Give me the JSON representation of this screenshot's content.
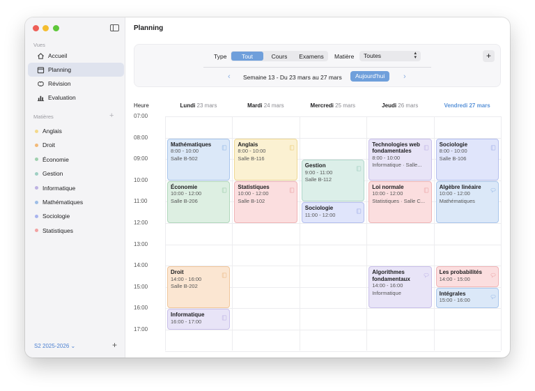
{
  "sidebar": {
    "section_vues": "Vues",
    "nav": [
      {
        "label": "Accueil",
        "icon": "house-icon"
      },
      {
        "label": "Planning",
        "icon": "calendar-icon",
        "active": true
      },
      {
        "label": "Révision",
        "icon": "brain-icon"
      },
      {
        "label": "Evaluation",
        "icon": "chart-bar-icon"
      }
    ],
    "section_matieres": "Matières",
    "subjects": [
      {
        "label": "Anglais",
        "color": "#f3d98b"
      },
      {
        "label": "Droit",
        "color": "#f2b978"
      },
      {
        "label": "Économie",
        "color": "#9fd0ae"
      },
      {
        "label": "Gestion",
        "color": "#9fcfc3"
      },
      {
        "label": "Informatique",
        "color": "#bdb2e2"
      },
      {
        "label": "Mathématiques",
        "color": "#9dbde6"
      },
      {
        "label": "Sociologie",
        "color": "#a8b3ee"
      },
      {
        "label": "Statistiques",
        "color": "#f2a2a2"
      }
    ],
    "semester": "S2 2025-2026"
  },
  "header": {
    "title": "Planning"
  },
  "toolbar": {
    "type_label": "Type",
    "type_options": [
      "Tout",
      "Cours",
      "Examens"
    ],
    "type_selected": "Tout",
    "matiere_label": "Matière",
    "matiere_value": "Toutes",
    "add_label": "+",
    "week_label": "Semaine 13 - Du 23 mars au 27 mars",
    "today_label": "Aujourd'hui"
  },
  "calendar": {
    "hour_header": "Heure",
    "days": [
      {
        "name": "Lundi",
        "date": "23 mars"
      },
      {
        "name": "Mardi",
        "date": "24 mars"
      },
      {
        "name": "Mercredi",
        "date": "25 mars"
      },
      {
        "name": "Jeudi",
        "date": "26 mars"
      },
      {
        "name": "Vendredi",
        "date": "27 mars",
        "today": true
      }
    ],
    "hours": [
      "07:00",
      "08:00",
      "09:00",
      "10:00",
      "11:00",
      "12:00",
      "13:00",
      "14:00",
      "15:00",
      "16:00",
      "17:00"
    ],
    "events": [
      {
        "day": 0,
        "start": 8,
        "end": 10,
        "title": "Mathématiques",
        "time": "8:00 - 10:00",
        "detail": "Salle B-502",
        "kind": "cours",
        "subject": "Mathématiques"
      },
      {
        "day": 0,
        "start": 10,
        "end": 12,
        "title": "Économie",
        "time": "10:00 - 12:00",
        "detail": "Salle B-206",
        "kind": "cours",
        "subject": "Économie"
      },
      {
        "day": 0,
        "start": 14,
        "end": 16,
        "title": "Droit",
        "time": "14:00 - 16:00",
        "detail": "Salle B-202",
        "kind": "cours",
        "subject": "Droit"
      },
      {
        "day": 0,
        "start": 16,
        "end": 17,
        "title": "Informatique",
        "time": "16:00 - 17:00",
        "detail": "",
        "kind": "cours",
        "subject": "Informatique"
      },
      {
        "day": 1,
        "start": 8,
        "end": 10,
        "title": "Anglais",
        "time": "8:00 - 10:00",
        "detail": "Salle B-116",
        "kind": "cours",
        "subject": "Anglais"
      },
      {
        "day": 1,
        "start": 10,
        "end": 12,
        "title": "Statistiques",
        "time": "10:00 - 12:00",
        "detail": "Salle B-102",
        "kind": "cours",
        "subject": "Statistiques"
      },
      {
        "day": 2,
        "start": 9,
        "end": 11,
        "title": "Gestion",
        "time": "9:00 - 11:00",
        "detail": "Salle B-112",
        "kind": "cours",
        "subject": "Gestion"
      },
      {
        "day": 2,
        "start": 11,
        "end": 12,
        "title": "Sociologie",
        "time": "11:00 - 12:00",
        "detail": "",
        "kind": "cours",
        "subject": "Sociologie"
      },
      {
        "day": 3,
        "start": 8,
        "end": 10,
        "title": "Technologies web fondamentales",
        "time": "8:00 - 10:00",
        "detail": "Informatique · Salle...",
        "kind": "cours",
        "subject": "Informatique"
      },
      {
        "day": 3,
        "start": 10,
        "end": 12,
        "title": "Loi normale",
        "time": "10:00 - 12:00",
        "detail": "Statistiques · Salle C...",
        "kind": "cours",
        "subject": "Statistiques"
      },
      {
        "day": 3,
        "start": 14,
        "end": 16,
        "title": "Algorithmes fondamentaux",
        "time": "14:00 - 16:00",
        "detail": "Informatique",
        "kind": "examen",
        "subject": "Informatique"
      },
      {
        "day": 4,
        "start": 8,
        "end": 10,
        "title": "Sociologie",
        "time": "8:00 - 10:00",
        "detail": "Salle B-106",
        "kind": "cours",
        "subject": "Sociologie"
      },
      {
        "day": 4,
        "start": 10,
        "end": 12,
        "title": "Algèbre linéaire",
        "time": "10:00 - 12:00",
        "detail": "Mathématiques",
        "kind": "examen",
        "subject": "Mathématiques"
      },
      {
        "day": 4,
        "start": 14,
        "end": 15,
        "title": "Les probabilités",
        "time": "14:00 - 15:00",
        "detail": "",
        "kind": "examen",
        "subject": "Statistiques"
      },
      {
        "day": 4,
        "start": 15,
        "end": 16,
        "title": "Intégrales",
        "time": "15:00 - 16:00",
        "detail": "",
        "kind": "examen",
        "subject": "Mathématiques"
      }
    ]
  },
  "colors": {
    "accent": "#6f9fdb",
    "subjects": {
      "Mathématiques": {
        "bg": "#dbe8f8",
        "border": "#a9c6ec"
      },
      "Économie": {
        "bg": "#ddefe2",
        "border": "#b1d8bc"
      },
      "Droit": {
        "bg": "#fbe6d2",
        "border": "#f0c69c"
      },
      "Informatique": {
        "bg": "#e8e4f7",
        "border": "#c9c0ea"
      },
      "Anglais": {
        "bg": "#fbf1d2",
        "border": "#efd894"
      },
      "Statistiques": {
        "bg": "#fbdedf",
        "border": "#f0b4b6"
      },
      "Gestion": {
        "bg": "#dcefe9",
        "border": "#b1d7cb"
      },
      "Sociologie": {
        "bg": "#e0e5fb",
        "border": "#b4bfee"
      }
    }
  }
}
